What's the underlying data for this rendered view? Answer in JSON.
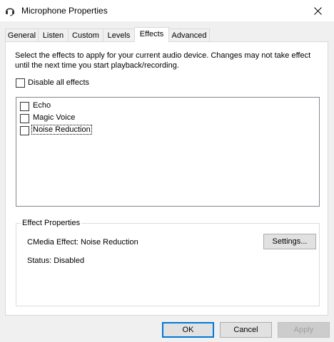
{
  "window": {
    "title": "Microphone Properties",
    "icon": "microphone-icon",
    "close_icon": "close-icon"
  },
  "tabs": [
    {
      "label": "General",
      "active": false
    },
    {
      "label": "Listen",
      "active": false
    },
    {
      "label": "Custom",
      "active": false
    },
    {
      "label": "Levels",
      "active": false
    },
    {
      "label": "Effects",
      "active": true
    },
    {
      "label": "Advanced",
      "active": false
    }
  ],
  "effects": {
    "description": "Select the effects to apply for your current audio device. Changes may not take effect until the next time you start playback/recording.",
    "disable_all_label": "Disable all effects",
    "disable_all_checked": false,
    "items": [
      {
        "label": "Echo",
        "checked": false
      },
      {
        "label": "Magic Voice",
        "checked": false
      },
      {
        "label": "Noise Reduction",
        "checked": false,
        "focused": true
      }
    ]
  },
  "effect_properties": {
    "group_title": "Effect Properties",
    "effect_text": "CMedia Effect: Noise Reduction",
    "status_text": "Status: Disabled",
    "settings_label": "Settings..."
  },
  "footer": {
    "ok_label": "OK",
    "cancel_label": "Cancel",
    "apply_label": "Apply"
  },
  "colors": {
    "focus_border": "#0078d7",
    "panel_bg": "#ffffff",
    "dialog_bg": "#f0f0f0"
  }
}
